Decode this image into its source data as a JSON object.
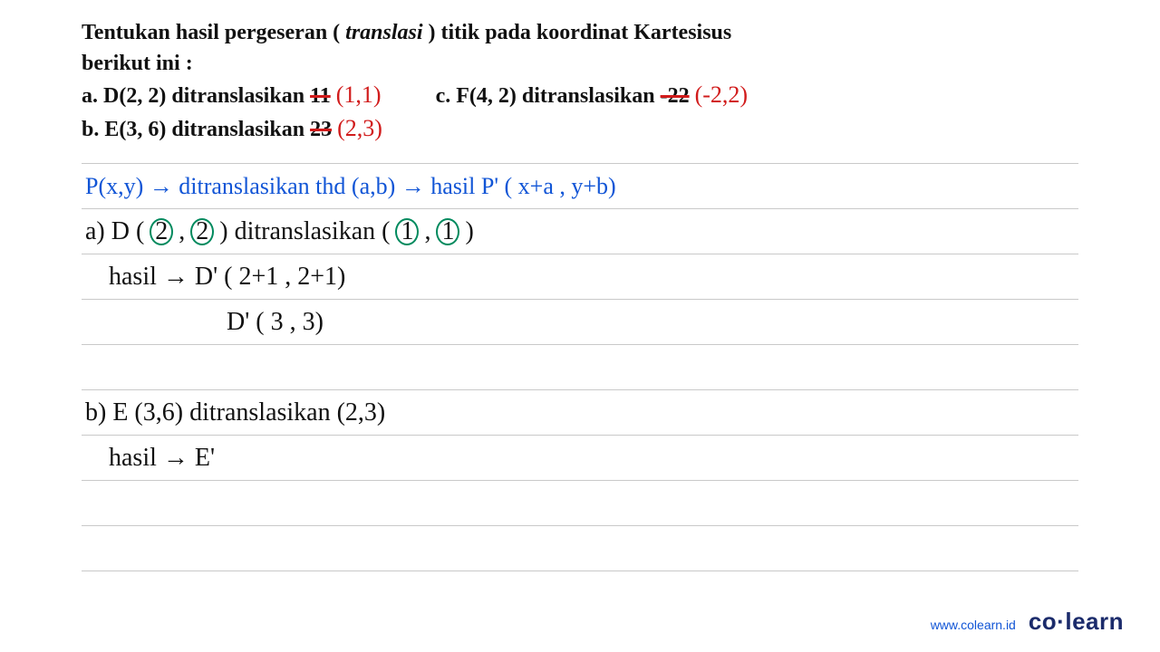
{
  "question": {
    "line1_part1": "Tentukan hasil pergeseran (",
    "line1_italic": "translasi",
    "line1_part2": ") titik pada koordinat Kartesisus",
    "line2": "berikut ini :",
    "a_prefix": "a. D(2, 2) ditranslasikan ",
    "a_struck": "11",
    "a_correction": "(1,1)",
    "b_prefix": "b. E(3, 6) ditranslasikan ",
    "b_struck": "23",
    "b_correction": "(2,3)",
    "c_prefix": "c. F(4, 2) ditranslasikan ",
    "c_struck": "-22",
    "c_correction": "(-2,2)"
  },
  "rule": "P(x,y) → ditranslasikan thd (a,b) → hasil P' ( x+a , y+b)",
  "work": {
    "a_head_1": "a) D (",
    "a_circ1": "2",
    "a_comma": ",",
    "a_circ2": "2",
    "a_head_2": ") ditranslasikan (",
    "a_circ3": "1",
    "a_comma2": ",",
    "a_circ4": "1",
    "a_head_3": ")",
    "a_line2": "hasil → D' ( 2+1 , 2+1)",
    "a_line3": "D' ( 3 , 3)",
    "b_head": "b) E (3,6) ditranslasikan (2,3)",
    "b_line2": "hasil → E'"
  },
  "footer": {
    "url": "www.colearn.id",
    "brand": "co·learn"
  }
}
